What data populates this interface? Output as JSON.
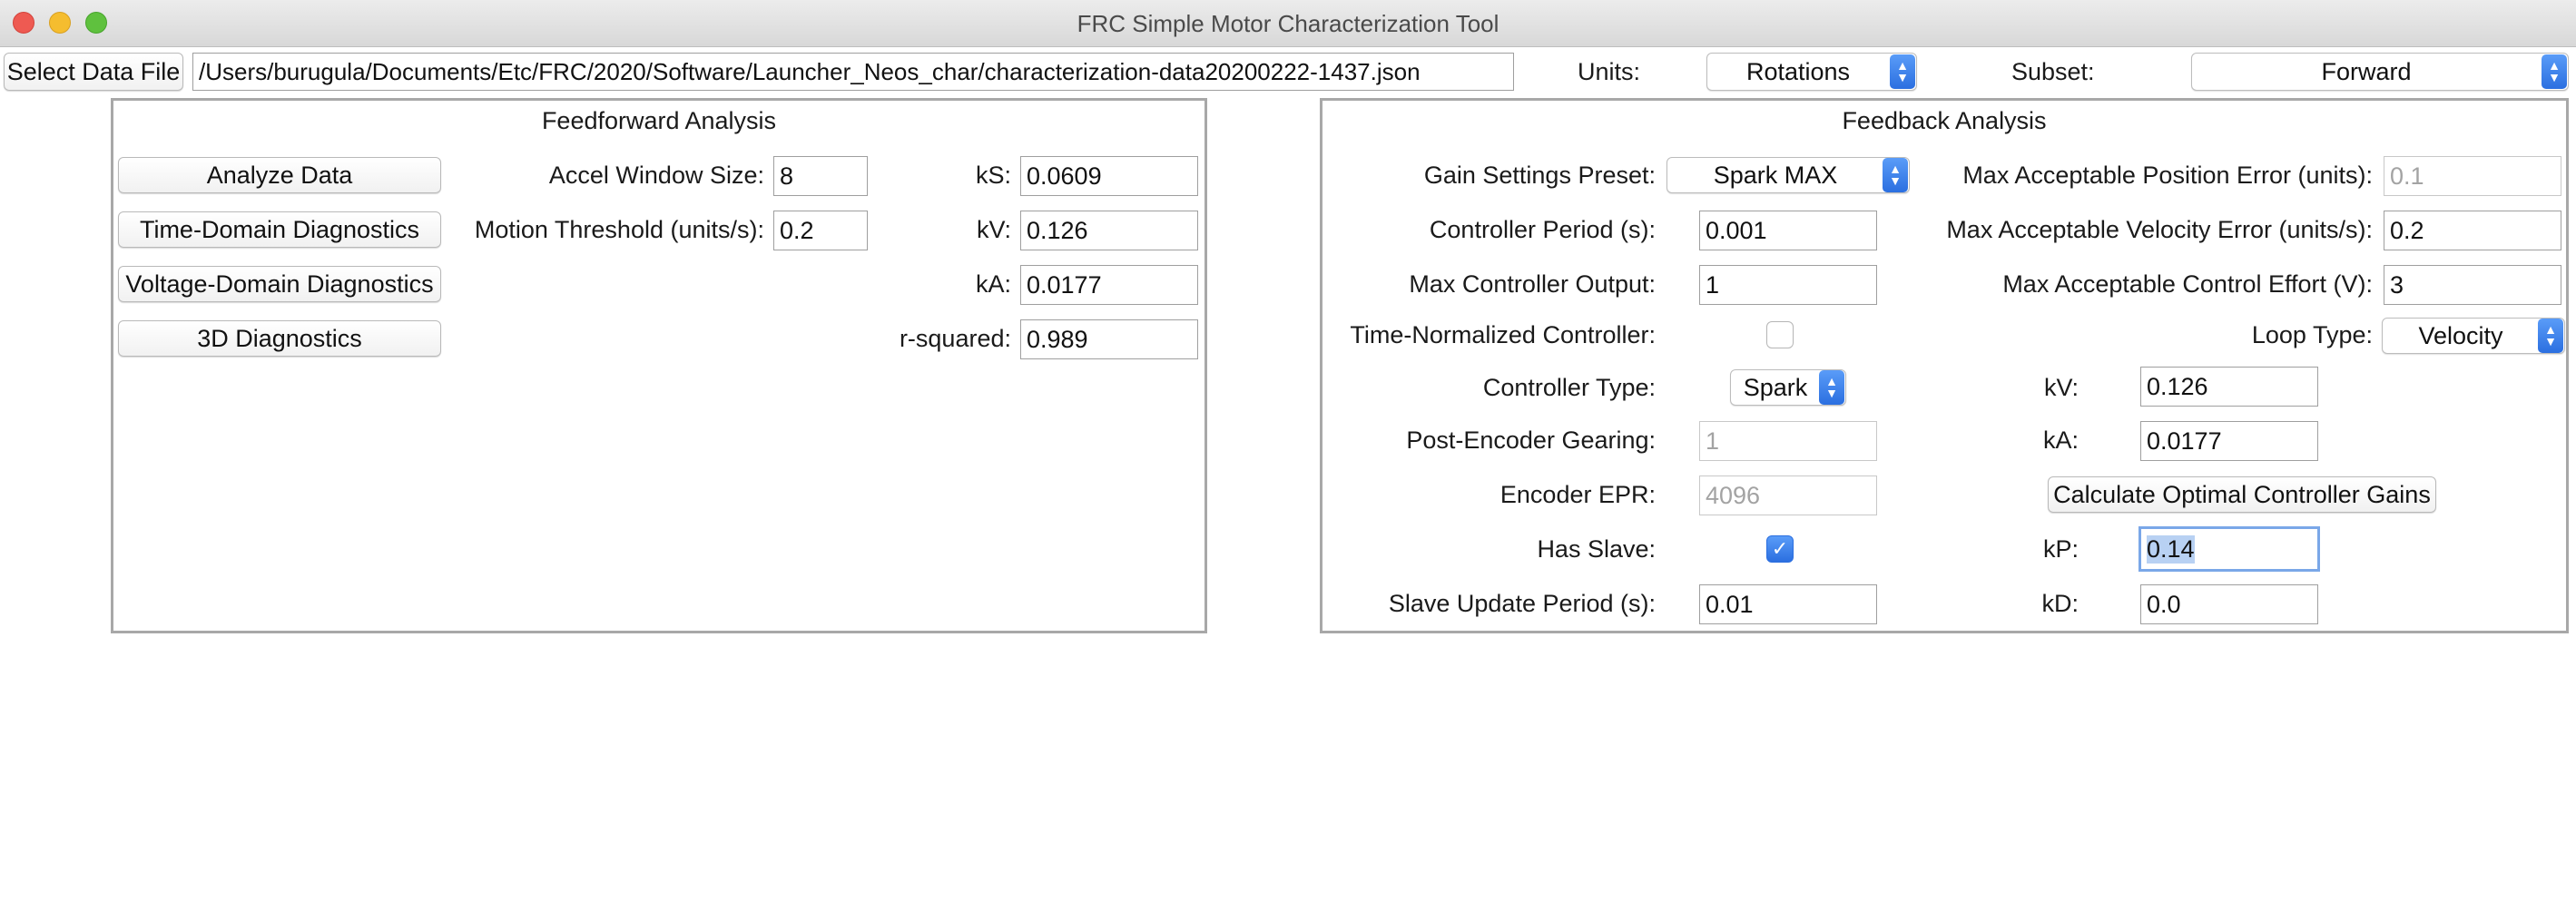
{
  "window": {
    "title": "FRC Simple Motor Characterization Tool"
  },
  "top_bar": {
    "select_file_label": "Select Data File",
    "file_path": "/Users/burugula/Documents/Etc/FRC/2020/Software/Launcher_Neos_char/characterization-data20200222-1437.json",
    "units_label": "Units:",
    "units_value": "Rotations",
    "subset_label": "Subset:",
    "subset_value": "Forward"
  },
  "feedforward": {
    "title": "Feedforward Analysis",
    "buttons": {
      "analyze": "Analyze Data",
      "time_domain": "Time-Domain Diagnostics",
      "voltage_domain": "Voltage-Domain Diagnostics",
      "three_d": "3D Diagnostics"
    },
    "accel_window_label": "Accel Window Size:",
    "accel_window_value": "8",
    "motion_threshold_label": "Motion Threshold (units/s):",
    "motion_threshold_value": "0.2",
    "ks_label": "kS:",
    "ks_value": "0.0609",
    "kv_label": "kV:",
    "kv_value": "0.126",
    "ka_label": "kA:",
    "ka_value": "0.0177",
    "r2_label": "r-squared:",
    "r2_value": "0.989"
  },
  "feedback": {
    "title": "Feedback Analysis",
    "gain_preset_label": "Gain Settings Preset:",
    "gain_preset_value": "Spark MAX",
    "controller_period_label": "Controller Period (s):",
    "controller_period_value": "0.001",
    "max_output_label": "Max Controller Output:",
    "max_output_value": "1",
    "time_normalized_label": "Time-Normalized Controller:",
    "time_normalized_checked": false,
    "controller_type_label": "Controller Type:",
    "controller_type_value": "Spark",
    "post_encoder_label": "Post-Encoder Gearing:",
    "post_encoder_value": "1",
    "encoder_epr_label": "Encoder EPR:",
    "encoder_epr_value": "4096",
    "has_slave_label": "Has Slave:",
    "has_slave_checked": true,
    "slave_update_label": "Slave Update Period (s):",
    "slave_update_value": "0.01",
    "max_pos_err_label": "Max Acceptable Position Error (units):",
    "max_pos_err_value": "0.1",
    "max_vel_err_label": "Max Acceptable Velocity Error (units/s):",
    "max_vel_err_value": "0.2",
    "max_effort_label": "Max Acceptable Control Effort (V):",
    "max_effort_value": "3",
    "loop_type_label": "Loop Type:",
    "loop_type_value": "Velocity",
    "kv_label": "kV:",
    "kv_value": "0.126",
    "ka_label": "kA:",
    "ka_value": "0.0177",
    "calc_button": "Calculate Optimal Controller Gains",
    "kp_label": "kP:",
    "kp_value": "0.14",
    "kd_label": "kD:",
    "kd_value": "0.0"
  },
  "colors": {
    "accent": "#2b6fe0",
    "close": "#ee5a52",
    "minimize": "#f5bd2f",
    "zoom": "#5fc13e"
  }
}
